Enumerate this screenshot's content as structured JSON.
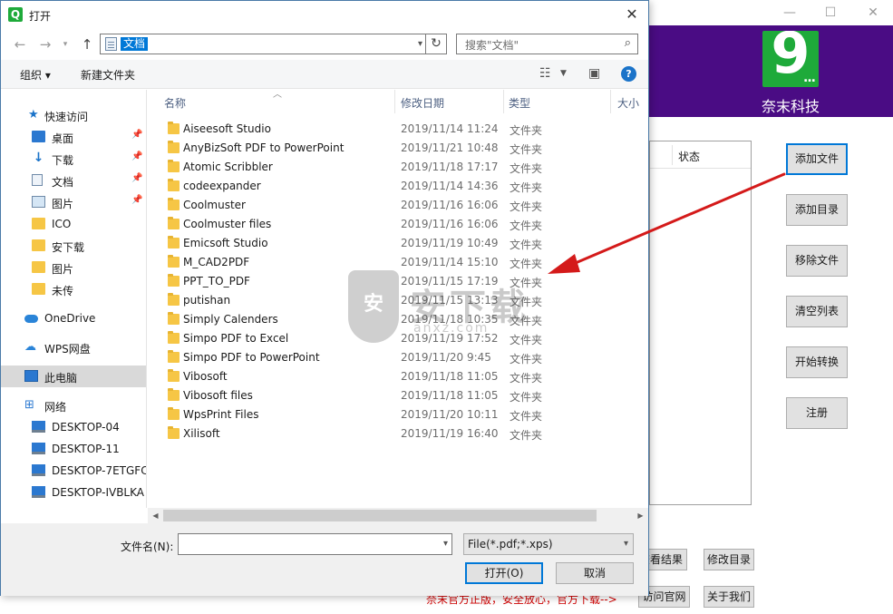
{
  "app": {
    "brand": "奈末科技",
    "logo_digit": "9",
    "logo_dots": "...",
    "status_header": "状态",
    "side_buttons": [
      "添加文件",
      "添加目录",
      "移除文件",
      "清空列表",
      "开始转换",
      "注册"
    ],
    "bottom_buttons": [
      "查看结果",
      "修改目录"
    ],
    "notice": "奈末官方正版，安全放心，官方下载-->",
    "link_buttons": [
      "访问官网",
      "关于我们"
    ]
  },
  "dialog": {
    "title": "打开",
    "app_icon_letter": "Q",
    "address": "文档",
    "search_placeholder": "搜索\"文档\"",
    "toolbar": {
      "organize": "组织 ▾",
      "new_folder": "新建文件夹"
    },
    "nav": [
      {
        "label": "快速访问",
        "icon": "star-icon",
        "pinned": false
      },
      {
        "label": "桌面",
        "icon": "desktop-icon",
        "pinned": true
      },
      {
        "label": "下载",
        "icon": "download-icon",
        "pinned": true
      },
      {
        "label": "文档",
        "icon": "document-icon",
        "pinned": true
      },
      {
        "label": "图片",
        "icon": "picture-icon",
        "pinned": true
      },
      {
        "label": "ICO",
        "icon": "folder-icon",
        "pinned": false
      },
      {
        "label": "安下载",
        "icon": "folder-icon",
        "pinned": false
      },
      {
        "label": "图片",
        "icon": "folder-icon",
        "pinned": false
      },
      {
        "label": "未传",
        "icon": "folder-icon",
        "pinned": false
      },
      {
        "label": "OneDrive",
        "icon": "onedrive-icon",
        "pinned": false
      },
      {
        "label": "WPS网盘",
        "icon": "cloud-icon",
        "pinned": false
      },
      {
        "label": "此电脑",
        "icon": "computer-icon",
        "pinned": false
      },
      {
        "label": "网络",
        "icon": "network-icon",
        "pinned": false
      },
      {
        "label": "DESKTOP-04",
        "icon": "monitor-icon",
        "pinned": false
      },
      {
        "label": "DESKTOP-11",
        "icon": "monitor-icon",
        "pinned": false
      },
      {
        "label": "DESKTOP-7ETGFC",
        "icon": "monitor-icon",
        "pinned": false
      },
      {
        "label": "DESKTOP-IVBLKA",
        "icon": "monitor-icon",
        "pinned": false
      }
    ],
    "columns": {
      "name": "名称",
      "date": "修改日期",
      "type": "类型",
      "size": "大小"
    },
    "files": [
      {
        "name": "Aiseesoft Studio",
        "date": "2019/11/14 11:24",
        "type": "文件夹"
      },
      {
        "name": "AnyBizSoft PDF to PowerPoint",
        "date": "2019/11/21 10:48",
        "type": "文件夹"
      },
      {
        "name": "Atomic Scribbler",
        "date": "2019/11/18 17:17",
        "type": "文件夹"
      },
      {
        "name": "codeexpander",
        "date": "2019/11/14 14:36",
        "type": "文件夹"
      },
      {
        "name": "Coolmuster",
        "date": "2019/11/16 16:06",
        "type": "文件夹"
      },
      {
        "name": "Coolmuster files",
        "date": "2019/11/16 16:06",
        "type": "文件夹"
      },
      {
        "name": "Emicsoft Studio",
        "date": "2019/11/19 10:49",
        "type": "文件夹"
      },
      {
        "name": "M_CAD2PDF",
        "date": "2019/11/14 15:10",
        "type": "文件夹"
      },
      {
        "name": "PPT_TO_PDF",
        "date": "2019/11/15 17:19",
        "type": "文件夹"
      },
      {
        "name": "putishan",
        "date": "2019/11/15 13:13",
        "type": "文件夹"
      },
      {
        "name": "Simply Calenders",
        "date": "2019/11/18 10:35",
        "type": "文件夹"
      },
      {
        "name": "Simpo PDF to Excel",
        "date": "2019/11/19 17:52",
        "type": "文件夹"
      },
      {
        "name": "Simpo PDF to PowerPoint",
        "date": "2019/11/20 9:45",
        "type": "文件夹"
      },
      {
        "name": "Vibosoft",
        "date": "2019/11/18 11:05",
        "type": "文件夹"
      },
      {
        "name": "Vibosoft files",
        "date": "2019/11/18 11:05",
        "type": "文件夹"
      },
      {
        "name": "WpsPrint Files",
        "date": "2019/11/20 10:11",
        "type": "文件夹"
      },
      {
        "name": "Xilisoft",
        "date": "2019/11/19 16:40",
        "type": "文件夹"
      }
    ],
    "filename_label": "文件名(N):",
    "filename_value": "",
    "filter_value": "File(*.pdf;*.xps)",
    "open_label": "打开(O)",
    "cancel_label": "取消"
  },
  "watermark": {
    "text": "安下载",
    "sub": "anxz.com",
    "badge": "安"
  },
  "colors": {
    "banner": "#4a0c84",
    "logo": "#1eaa3a",
    "arrow": "#d41a1a",
    "selection": "#0078d7"
  }
}
